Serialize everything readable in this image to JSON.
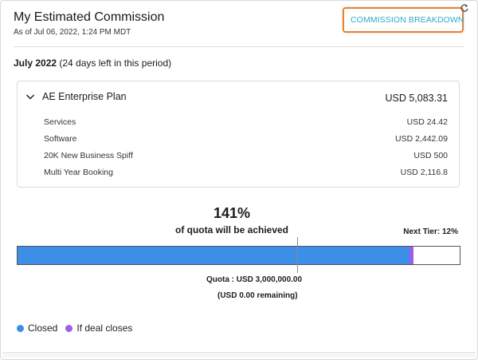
{
  "header": {
    "title": "My Estimated Commission",
    "as_of": "As of Jul 06, 2022, 1:24 PM MDT"
  },
  "commission_breakdown_button": {
    "label": "COMMISSION BREAKDOWN",
    "border_color": "#e0843a",
    "text_color": "#2fa9c7"
  },
  "icons": {
    "refresh": "refresh-icon",
    "logo": "spiff-logo-icon",
    "chevron": "chevron-down-icon"
  },
  "period": {
    "name": "July 2022",
    "remaining": " (24 days left in this period)"
  },
  "plan": {
    "name": "AE Enterprise Plan",
    "total": "USD 5,083.31",
    "rows": [
      {
        "label": "Services",
        "value": "USD 24.42"
      },
      {
        "label": "Software",
        "value": "USD 2,442.09"
      },
      {
        "label": "20K New Business Spiff",
        "value": "USD 500"
      },
      {
        "label": "Multi Year Booking",
        "value": "USD 2,116.8"
      }
    ]
  },
  "progress": {
    "percent_label": "141%",
    "caption": "of quota will be achieved",
    "next_tier": "Next Tier: 12%",
    "closed_fraction": 0.886,
    "if_deal_fraction": 0.009,
    "quota_marker_fraction": 0.633,
    "quota_label": "Quota :  USD 3,000,000.00",
    "remaining_label": "(USD 0.00  remaining)",
    "colors": {
      "closed": "#3d8ee6",
      "if_deal": "#9d5ee8"
    }
  },
  "legend": [
    {
      "label": "Closed",
      "color": "#3d8ee6"
    },
    {
      "label": "If deal closes",
      "color": "#9d5ee8"
    }
  ]
}
